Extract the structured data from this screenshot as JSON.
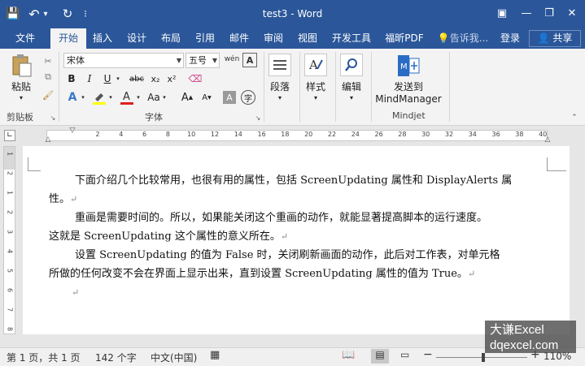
{
  "window": {
    "title": "test3 - Word",
    "minimize": "—",
    "restore": "❐",
    "close": "✕",
    "ribbon_options": "▣"
  },
  "quick_access": {
    "save": "💾",
    "undo": "↶",
    "undo_menu": "▾",
    "redo": "↻",
    "customize": "⁝"
  },
  "tabs": [
    "文件",
    "开始",
    "插入",
    "设计",
    "布局",
    "引用",
    "邮件",
    "审阅",
    "视图",
    "开发工具",
    "福昕PDF"
  ],
  "tell_me": "告诉我...",
  "login": "登录",
  "share": "共享",
  "ribbon": {
    "clipboard": {
      "paste": "粘贴",
      "label": "剪贴板"
    },
    "font": {
      "font_name": "宋体",
      "font_size": "五号",
      "wen": "wén",
      "bold": "B",
      "italic": "I",
      "underline": "U",
      "strike": "abc",
      "subscript": "x₂",
      "superscript": "x²",
      "label": "字体",
      "grow": "A",
      "shrink": "A",
      "aa": "Aa",
      "highlight_letter": "A",
      "char_shading": "A",
      "enclose": "字"
    },
    "paragraph": {
      "label": "段落"
    },
    "styles": {
      "label": "样式"
    },
    "editing": {
      "label": "编辑"
    },
    "mindjet": {
      "send": "发送到",
      "app": "MindManager",
      "label": "Mindjet"
    }
  },
  "ruler": {
    "numbers": [
      "2",
      "4",
      "6",
      "8",
      "10",
      "12",
      "14",
      "16",
      "18",
      "20",
      "22",
      "24",
      "26",
      "28",
      "30",
      "32",
      "34",
      "36",
      "38",
      "40"
    ]
  },
  "vruler": {
    "numbers": [
      "1",
      "2",
      "1",
      "2",
      "3",
      "4",
      "5",
      "6",
      "7",
      "8"
    ]
  },
  "document": {
    "lines": [
      "下面介绍几个比较常用，也很有用的属性，包括 ScreenUpdating 属性和 DisplayAlerts 属",
      "性。",
      "重画是需要时间的。所以，如果能关闭这个重画的动作，就能显著提高脚本的运行速度。",
      "这就是 ScreenUpdating 这个属性的意义所在。",
      "设置 ScreenUpdating 的值为 False 时，关闭刷新画面的动作，此后对工作表，对单元格",
      "所做的任何改变不会在界面上显示出来，直到设置 ScreenUpdating 属性的值为 True。"
    ],
    "para_mark": "↵"
  },
  "status": {
    "page": "第 1 页，共 1 页",
    "words": "142 个字",
    "language": "中文(中国)",
    "zoom": "110%"
  },
  "watermark": {
    "line1": "大谦Excel",
    "line2": "dqexcel.com"
  }
}
